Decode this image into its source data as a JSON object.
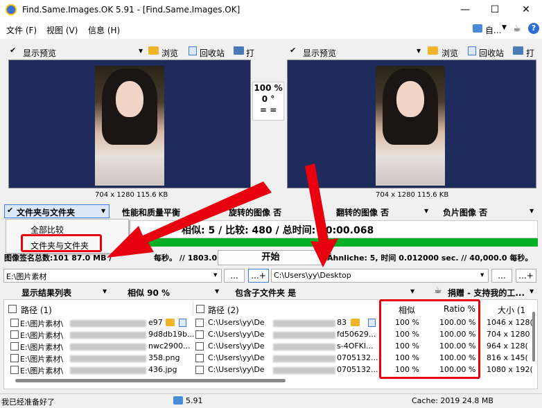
{
  "window": {
    "title": "Find.Same.Images.OK 5.91 - [Find.Same.Images.OK]",
    "min": "—",
    "max": "☐",
    "close": "✕"
  },
  "menu": {
    "items": [
      "文件 (F)",
      "视图 (V)",
      "信息 (H)"
    ],
    "right_label": "自..."
  },
  "left_pane": {
    "show_preview": "显示预览",
    "browse": "浏览",
    "recycle": "回收站",
    "print": "打",
    "dims": "704 x 1280 115.6 KB"
  },
  "right_pane": {
    "show_preview": "显示预览",
    "browse": "浏览",
    "recycle": "回收站",
    "print": "打",
    "dims": "704 x 1280 115.6 KB"
  },
  "center": {
    "percent": "100 %",
    "angle": "0 °",
    "equal": "= ="
  },
  "options": {
    "mode": "文件夹与文件夹",
    "quality": "性能和质量平衡",
    "rotated": "旋转的图像 否",
    "flipped": "翻转的图像 否",
    "negative": "负片图像 否"
  },
  "dropdown": {
    "items": [
      "全部比较",
      "文件夹与文件夹"
    ]
  },
  "stats": {
    "line": "相似: 5 / 比较: 480 / 总时间: 00:00.068",
    "progress": 1.0,
    "left_info": "图像签名总数:101  87.0 MB /  1803.0",
    "mid_info": "每秒。 // 1803.0",
    "right_info": "Ähnliche: 5, 时间 0.012000 sec. // 40,000.0 每秒。",
    "start": "开始"
  },
  "paths": {
    "left": "E:\\图片素材",
    "right": "C:\\Users\\yy\\Desktop",
    "dots": "...",
    "dotsplus": "...+"
  },
  "filters": {
    "show_list": "显示结果列表",
    "similar": "相似 90 %",
    "subfolders": "包含子文件夹 是",
    "donate": "捐赠 - 支持我的工..."
  },
  "grid": {
    "headers": {
      "path1": "路径 (1)",
      "path2": "路径 (2)",
      "similar": "相似",
      "ratio": "Ratio %",
      "size": "大小 (1"
    },
    "rows": [
      {
        "p1": "E:\\图片素材\\",
        "p1end": "e97",
        "p2": "C:\\Users\\yy\\De",
        "p2end": "83",
        "sim": "100 %",
        "ratio": "100.00 %",
        "size": "1046 x 128("
      },
      {
        "p1": "E:\\图片素材\\",
        "p1end": "9d8db19b...",
        "p2": "C:\\Users\\yy\\De",
        "p2end": "fd50629...",
        "sim": "100 %",
        "ratio": "100.00 %",
        "size": "704 x 1280"
      },
      {
        "p1": "E:\\图片素材\\",
        "p1end": "nwc2900...",
        "p2": "C:\\Users\\yy\\De",
        "p2end": "s-4OFKI...",
        "sim": "100 %",
        "ratio": "100.00 %",
        "size": "964 x 128("
      },
      {
        "p1": "E:\\图片素材\\",
        "p1end": "358.png",
        "p2": "C:\\Users\\yy\\De",
        "p2end": "0705132...",
        "sim": "100 %",
        "ratio": "100.00 %",
        "size": "816 x 145("
      },
      {
        "p1": "E:\\图片素材\\",
        "p1end": "436.jpg",
        "p2": "C:\\Users\\yy\\De",
        "p2end": "0705132...",
        "sim": "100 %",
        "ratio": "100.00 %",
        "size": "1080 x 192("
      }
    ]
  },
  "status": {
    "ready": "我已经准备好了",
    "version": "5.91",
    "cache": "Cache: 2019 24.8 MB"
  },
  "colors": {
    "accent_red": "#e8000e",
    "progress_green": "#06b025",
    "preview_bg": "#1e2b5c"
  }
}
